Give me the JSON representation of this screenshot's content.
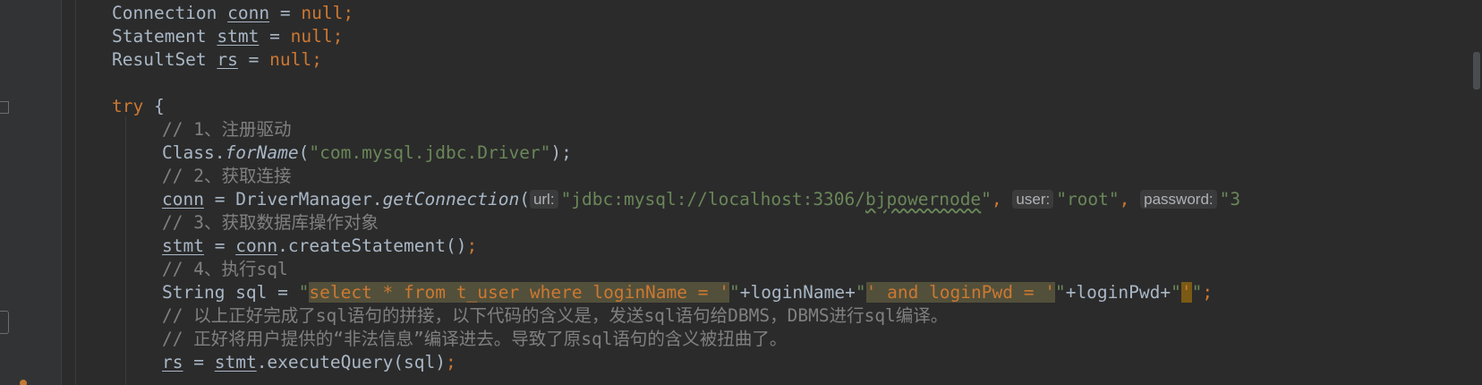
{
  "code": {
    "decl_conn": {
      "type": "Connection",
      "var": "conn",
      "op": " = ",
      "val": "null",
      "semi": ";"
    },
    "decl_stmt": {
      "type": "Statement",
      "var": "stmt",
      "op": " = ",
      "val": "null",
      "semi": ";"
    },
    "decl_rs": {
      "type": "ResultSet",
      "var": "rs",
      "op": " = ",
      "val": "null",
      "semi": ";"
    },
    "try_line": {
      "kw": "try",
      "brace": " {"
    },
    "comment1": "// 1、注册驱动",
    "class_forname": {
      "obj": "Class.",
      "method": "forName",
      "open": "(",
      "arg": "\"com.mysql.jdbc.Driver\"",
      "close": ");"
    },
    "comment2": "// 2、获取连接",
    "get_conn": {
      "var": "conn",
      "mid": " = DriverManager.",
      "method": "getConnection",
      "open": "(",
      "hint_url": "url:",
      "url_open": "\"jdbc:mysql://localhost:3306/",
      "url_db": "bjpowernode",
      "url_close": "\"",
      "sep1": ", ",
      "hint_user": "user:",
      "user_val": "\"root\"",
      "sep2": ", ",
      "hint_password": "password:",
      "pwd_tail": "\"3"
    },
    "comment3": "// 3、获取数据库操作对象",
    "create_stmt": {
      "var": "stmt",
      "eq": " = ",
      "obj": "conn",
      "rest": ".createStatement()",
      "semi": ";"
    },
    "comment4": "// 4、执行sql",
    "sql_line": {
      "prefix": "String sql = ",
      "q1": "\"",
      "s1": "select * from t_user where loginName = '",
      "q2": "\"",
      "concat1": "+loginName+",
      "q3": "\"",
      "s2": "' and loginPwd = '",
      "q4": "\"",
      "concat2": "+loginPwd+",
      "q5": "\"",
      "s3": "'",
      "q6": "\"",
      "semi": ";"
    },
    "comment5": "// 以上正好完成了sql语句的拼接，以下代码的含义是，发送sql语句给DBMS，DBMS进行sql编译。",
    "comment6": "// 正好将用户提供的“非法信息”编译进去。导致了原sql语句的含义被扭曲了。",
    "exec_query": {
      "var": "rs",
      "eq": " = ",
      "obj": "stmt",
      "rest": ".executeQuery(sql)",
      "semi": ";"
    }
  },
  "colors": {
    "background": "#2b2b2b",
    "keyword": "#cc7832",
    "string": "#6a8759",
    "comment": "#808080",
    "text": "#a9b7c6",
    "highlight": "#52503a"
  }
}
